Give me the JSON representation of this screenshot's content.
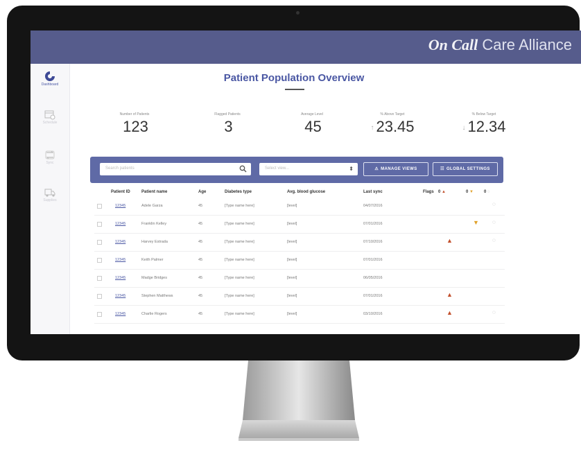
{
  "brand": {
    "bold": "On Call",
    "light": " Care Alliance"
  },
  "nav": [
    {
      "label": "Dashboard",
      "icon": "dashboard-logo-icon"
    },
    {
      "label": "Schedule",
      "icon": "calendar-icon"
    },
    {
      "label": "Sync",
      "icon": "sync-icon"
    },
    {
      "label": "Supplies",
      "icon": "truck-icon"
    }
  ],
  "page_title": "Patient Population Overview",
  "stats": [
    {
      "label": "Number of Patients",
      "value": "123",
      "arrow": ""
    },
    {
      "label": "Flagged Patients",
      "value": "3",
      "arrow": ""
    },
    {
      "label": "Average Level",
      "value": "45",
      "arrow": ""
    },
    {
      "label": "% Above Target",
      "value": "23.45",
      "arrow": "↑"
    },
    {
      "label": "% Below Target",
      "value": "12.34",
      "arrow": "↓"
    }
  ],
  "filters": {
    "search_placeholder": "Search patients",
    "select_placeholder": "Select view...",
    "manage_views": "MANAGE VIEWS",
    "global_settings": "GLOBAL SETTINGS"
  },
  "table": {
    "headers": [
      "Patient ID",
      "Patient name",
      "Age",
      "Diabetes type",
      "Avg. blood glucose",
      "Last sync",
      "Flags"
    ],
    "flag_counts": {
      "high": "0",
      "low": "0",
      "sync": "0"
    },
    "rows": [
      {
        "id": "12345",
        "name": "Adele Garza",
        "age": "45",
        "type": "[Type name here]",
        "glucose": "[level]",
        "sync": "04/07/2016",
        "flag": "sync"
      },
      {
        "id": "12345",
        "name": "Franklin Kelley",
        "age": "45",
        "type": "[Type name here]",
        "glucose": "[level]",
        "sync": "07/01/2016",
        "flag": "low-sync"
      },
      {
        "id": "12345",
        "name": "Harvey Estrada",
        "age": "45",
        "type": "[Type name here]",
        "glucose": "[level]",
        "sync": "07/10/2016",
        "flag": "high-sync"
      },
      {
        "id": "12345",
        "name": "Keith Palmer",
        "age": "45",
        "type": "[Type name here]",
        "glucose": "[level]",
        "sync": "07/01/2016",
        "flag": ""
      },
      {
        "id": "12345",
        "name": "Madge Bridges",
        "age": "45",
        "type": "[Type name here]",
        "glucose": "[level]",
        "sync": "06/05/2016",
        "flag": ""
      },
      {
        "id": "12345",
        "name": "Stephen Matthews",
        "age": "45",
        "type": "[Type name here]",
        "glucose": "[level]",
        "sync": "07/01/2016",
        "flag": "high"
      },
      {
        "id": "12345",
        "name": "Charlie Rogers",
        "age": "45",
        "type": "[Type name here]",
        "glucose": "[level]",
        "sync": "03/10/2016",
        "flag": "high-sync"
      }
    ]
  },
  "colors": {
    "brand": "#565c8c",
    "accent": "#5f6aa6",
    "link": "#4a57a3",
    "flag_high": "#c2502c",
    "flag_low": "#e0a12a"
  }
}
